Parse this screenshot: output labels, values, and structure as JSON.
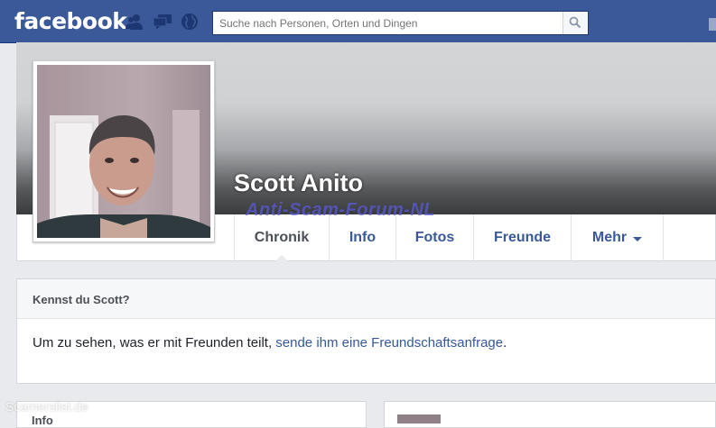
{
  "header": {
    "logo": "facebook",
    "search": {
      "placeholder": "Suche nach Personen, Orten und Dingen"
    },
    "icons": [
      "friend-requests-icon",
      "messages-icon",
      "notifications-globe-icon",
      "search-icon"
    ]
  },
  "profile": {
    "name": "Scott Anito",
    "tabs": [
      {
        "label": "Chronik",
        "active": true
      },
      {
        "label": "Info"
      },
      {
        "label": "Fotos"
      },
      {
        "label": "Freunde"
      },
      {
        "label": "Mehr"
      }
    ]
  },
  "know_box": {
    "title": "Kennst du Scott?",
    "text_before": "Um zu sehen, was er mit Freunden teilt, ",
    "link": "sende ihm eine Freundschaftsanfrage",
    "text_after": "."
  },
  "lower": {
    "left_title": "Info"
  },
  "watermarks": {
    "overlay": "Anti-Scam-Forum-NL",
    "corner": "Scamerslist.de"
  },
  "colors": {
    "brand_blue": "#3b5998",
    "link_blue": "#365899",
    "page_bg": "#e9eaed"
  }
}
